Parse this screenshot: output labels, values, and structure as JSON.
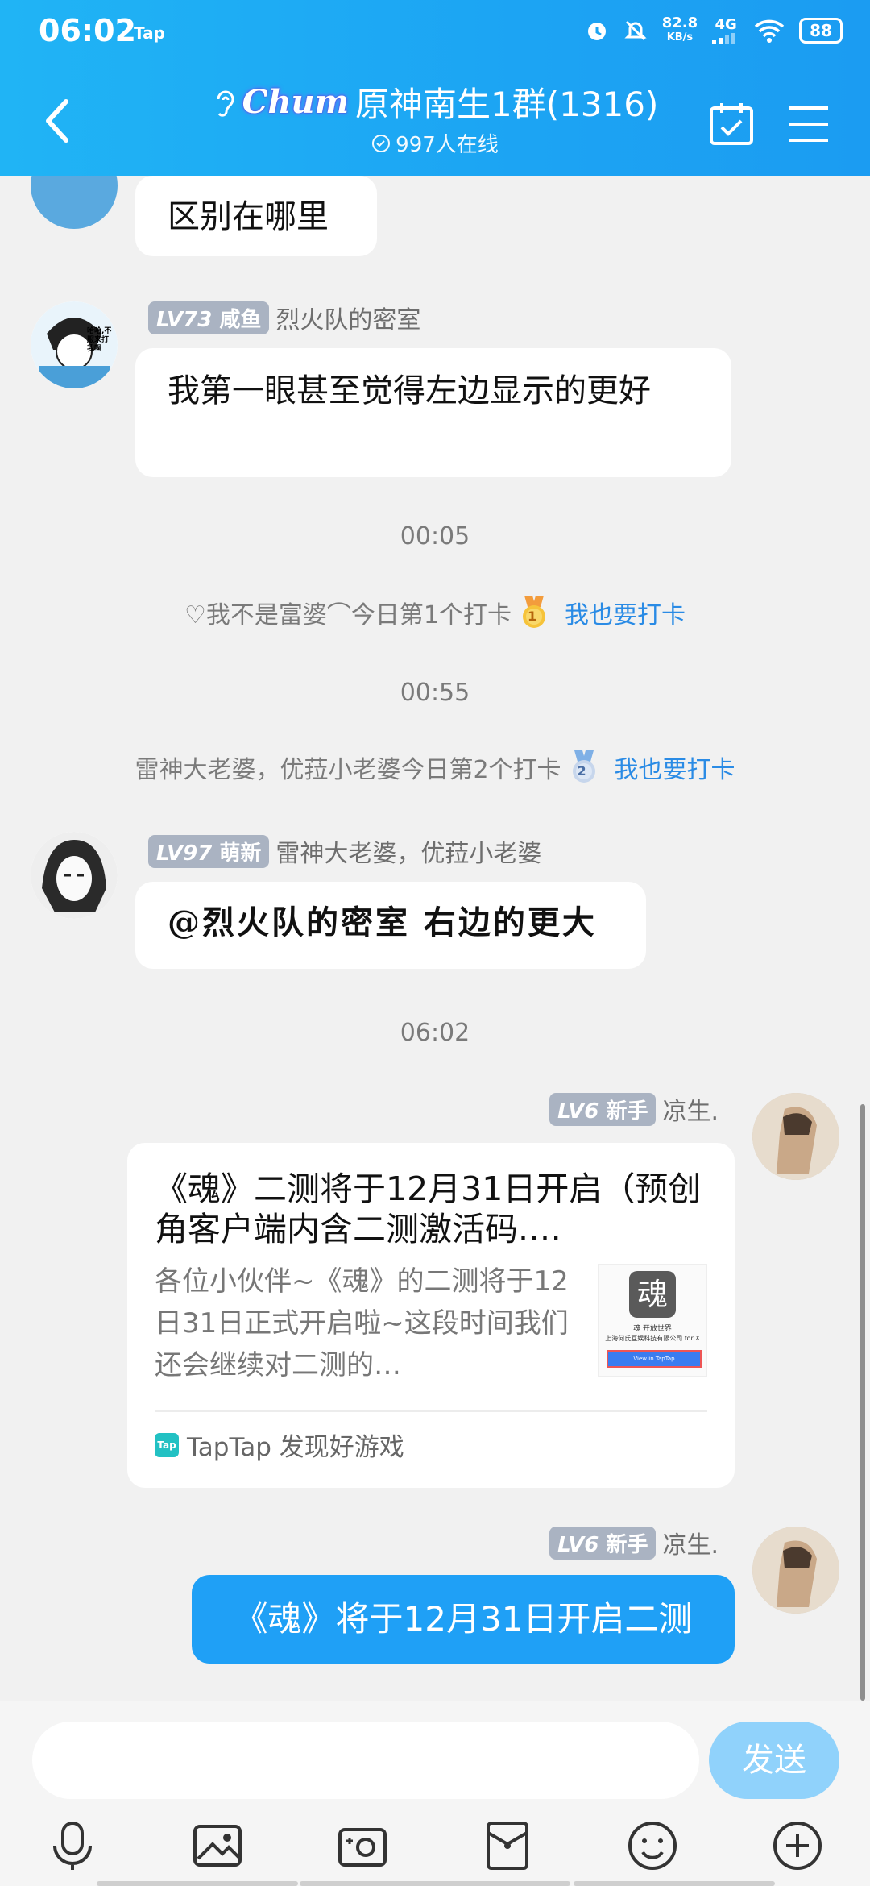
{
  "status": {
    "time": "06:02",
    "tap_label": "Tap",
    "speed_value": "82.8",
    "speed_unit": "KB/s",
    "network": "4G",
    "battery": "88"
  },
  "header": {
    "chum_label": "Chum",
    "group_title": "原神南生1群(1316)",
    "online_text": "997人在线"
  },
  "messages": {
    "m0": {
      "text": "区别在哪里"
    },
    "m1": {
      "level": "LV73",
      "badge_title": "咸鱼",
      "sender": "烈火队的密室",
      "text": "我第一眼甚至觉得左边显示的更好",
      "avatar_text": "哈哈,不服来打我啊"
    },
    "ts1": "00:05",
    "sys1": {
      "text": "♡我不是富婆⌒今日第1个打卡",
      "medal": "1",
      "link": "我也要打卡"
    },
    "ts2": "00:55",
    "sys2": {
      "text": "雷神大老婆，优菈小老婆今日第2个打卡",
      "medal": "2",
      "link": "我也要打卡"
    },
    "m2": {
      "level": "LV97",
      "badge_title": "萌新",
      "sender": "雷神大老婆，优菈小老婆",
      "text": "@烈火队的密室 右边的更大"
    },
    "ts3": "06:02",
    "m3": {
      "level": "LV6",
      "badge_title": "新手",
      "sender": "凉生.",
      "card_title": "《魂》二测将于12月31日开启（预创角客户端内含二测激活码.…",
      "card_desc": "各位小伙伴~《魂》的二测将于12日31日正式开启啦~这段时间我们还会继续对二测的…",
      "thumb_char": "魂",
      "thumb_line1": "魂 开放世界",
      "thumb_line2": "上海何氏互娱科技有限公司 for X",
      "thumb_button": "View in TapTap",
      "source_icon": "Tap",
      "source": "TapTap 发现好游戏"
    },
    "m4": {
      "level": "LV6",
      "badge_title": "新手",
      "sender": "凉生.",
      "text": "《魂》将于12月31日开启二测"
    }
  },
  "input": {
    "placeholder": "",
    "send_label": "发送"
  },
  "colors": {
    "header": "#1ca4f3",
    "accent": "#1fa0f6",
    "link": "#2a8be5",
    "send_disabled": "#90d2fb"
  },
  "icons": [
    "back-icon",
    "ear-icon",
    "calendar-check-icon",
    "menu-icon",
    "mic-icon",
    "image-icon",
    "camera-icon",
    "red-packet-icon",
    "emoji-icon",
    "plus-icon"
  ]
}
